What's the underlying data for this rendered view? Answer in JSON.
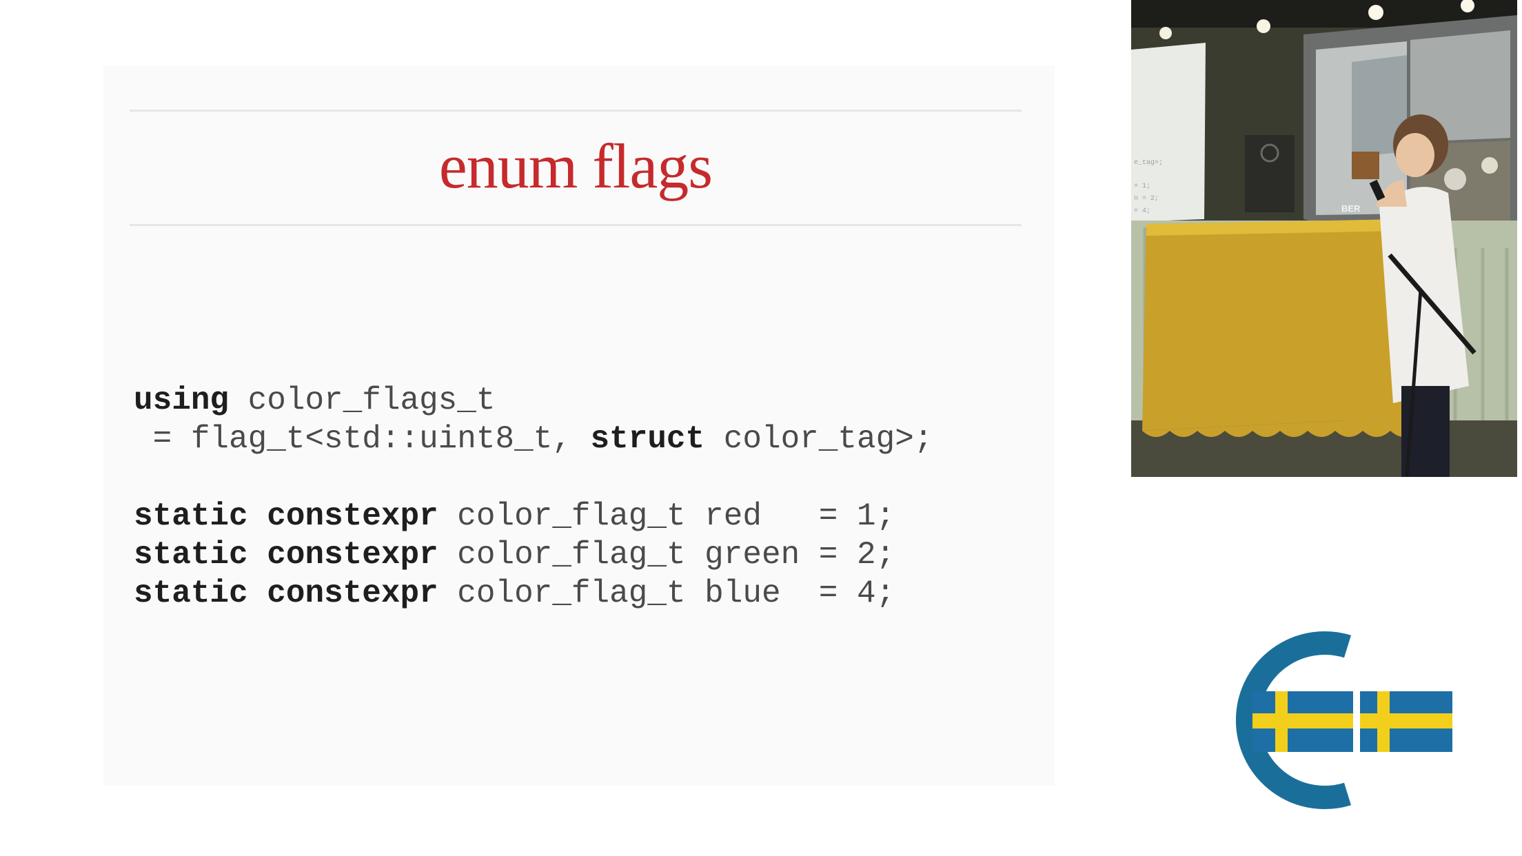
{
  "slide": {
    "title": "enum flags",
    "code_lines": [
      [
        {
          "t": "using",
          "kw": true
        },
        {
          "t": " color_flags_t",
          "kw": false
        }
      ],
      [
        {
          "t": " = flag_t<std::uint8_t, ",
          "kw": false
        },
        {
          "t": "struct",
          "kw": true
        },
        {
          "t": " color_tag>;",
          "kw": false
        }
      ],
      [],
      [
        {
          "t": "static",
          "kw": true
        },
        {
          "t": " ",
          "kw": false
        },
        {
          "t": "constexpr",
          "kw": true
        },
        {
          "t": " color_flag_t red   = 1;",
          "kw": false
        }
      ],
      [
        {
          "t": "static",
          "kw": true
        },
        {
          "t": " ",
          "kw": false
        },
        {
          "t": "constexpr",
          "kw": true
        },
        {
          "t": " color_flag_t green = 2;",
          "kw": false
        }
      ],
      [
        {
          "t": "static",
          "kw": true
        },
        {
          "t": " ",
          "kw": false
        },
        {
          "t": "constexpr",
          "kw": true
        },
        {
          "t": " color_flag_t blue  = 4;",
          "kw": false
        }
      ]
    ]
  },
  "video": {
    "screen_label": "BER",
    "screen_code": [
      "e_tag>;",
      "= 1;",
      "n = 2;",
      "= 4;"
    ]
  },
  "colors": {
    "title_red": "#c62a2c",
    "logo_blue": "#1a6f9a",
    "flag_blue": "#1d6fa6",
    "flag_yellow": "#f2cf1b"
  }
}
